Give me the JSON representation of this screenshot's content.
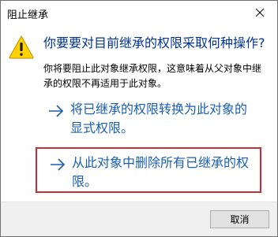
{
  "window": {
    "title": "阻止继承",
    "close_icon": "close-icon"
  },
  "dialog": {
    "icon": "warning-icon",
    "main_instruction": "你要要对目前继承的权限采取何种操作?",
    "content": "你将要阻止此对象继承权限，这意味着从父对象中继承的权限不再适用于此对象。",
    "options": [
      {
        "label": "将已继承的权限转换为此对象的显式权限。",
        "icon": "arrow-right-icon"
      },
      {
        "label": "从此对象中删除所有已继承的权限。",
        "icon": "arrow-right-icon"
      }
    ]
  },
  "footer": {
    "cancel_label": "取消"
  },
  "colors": {
    "instruction": "#003399",
    "link": "#1a5fb4",
    "highlight_border": "#cc2a36",
    "warning_fill": "#ffd700"
  }
}
